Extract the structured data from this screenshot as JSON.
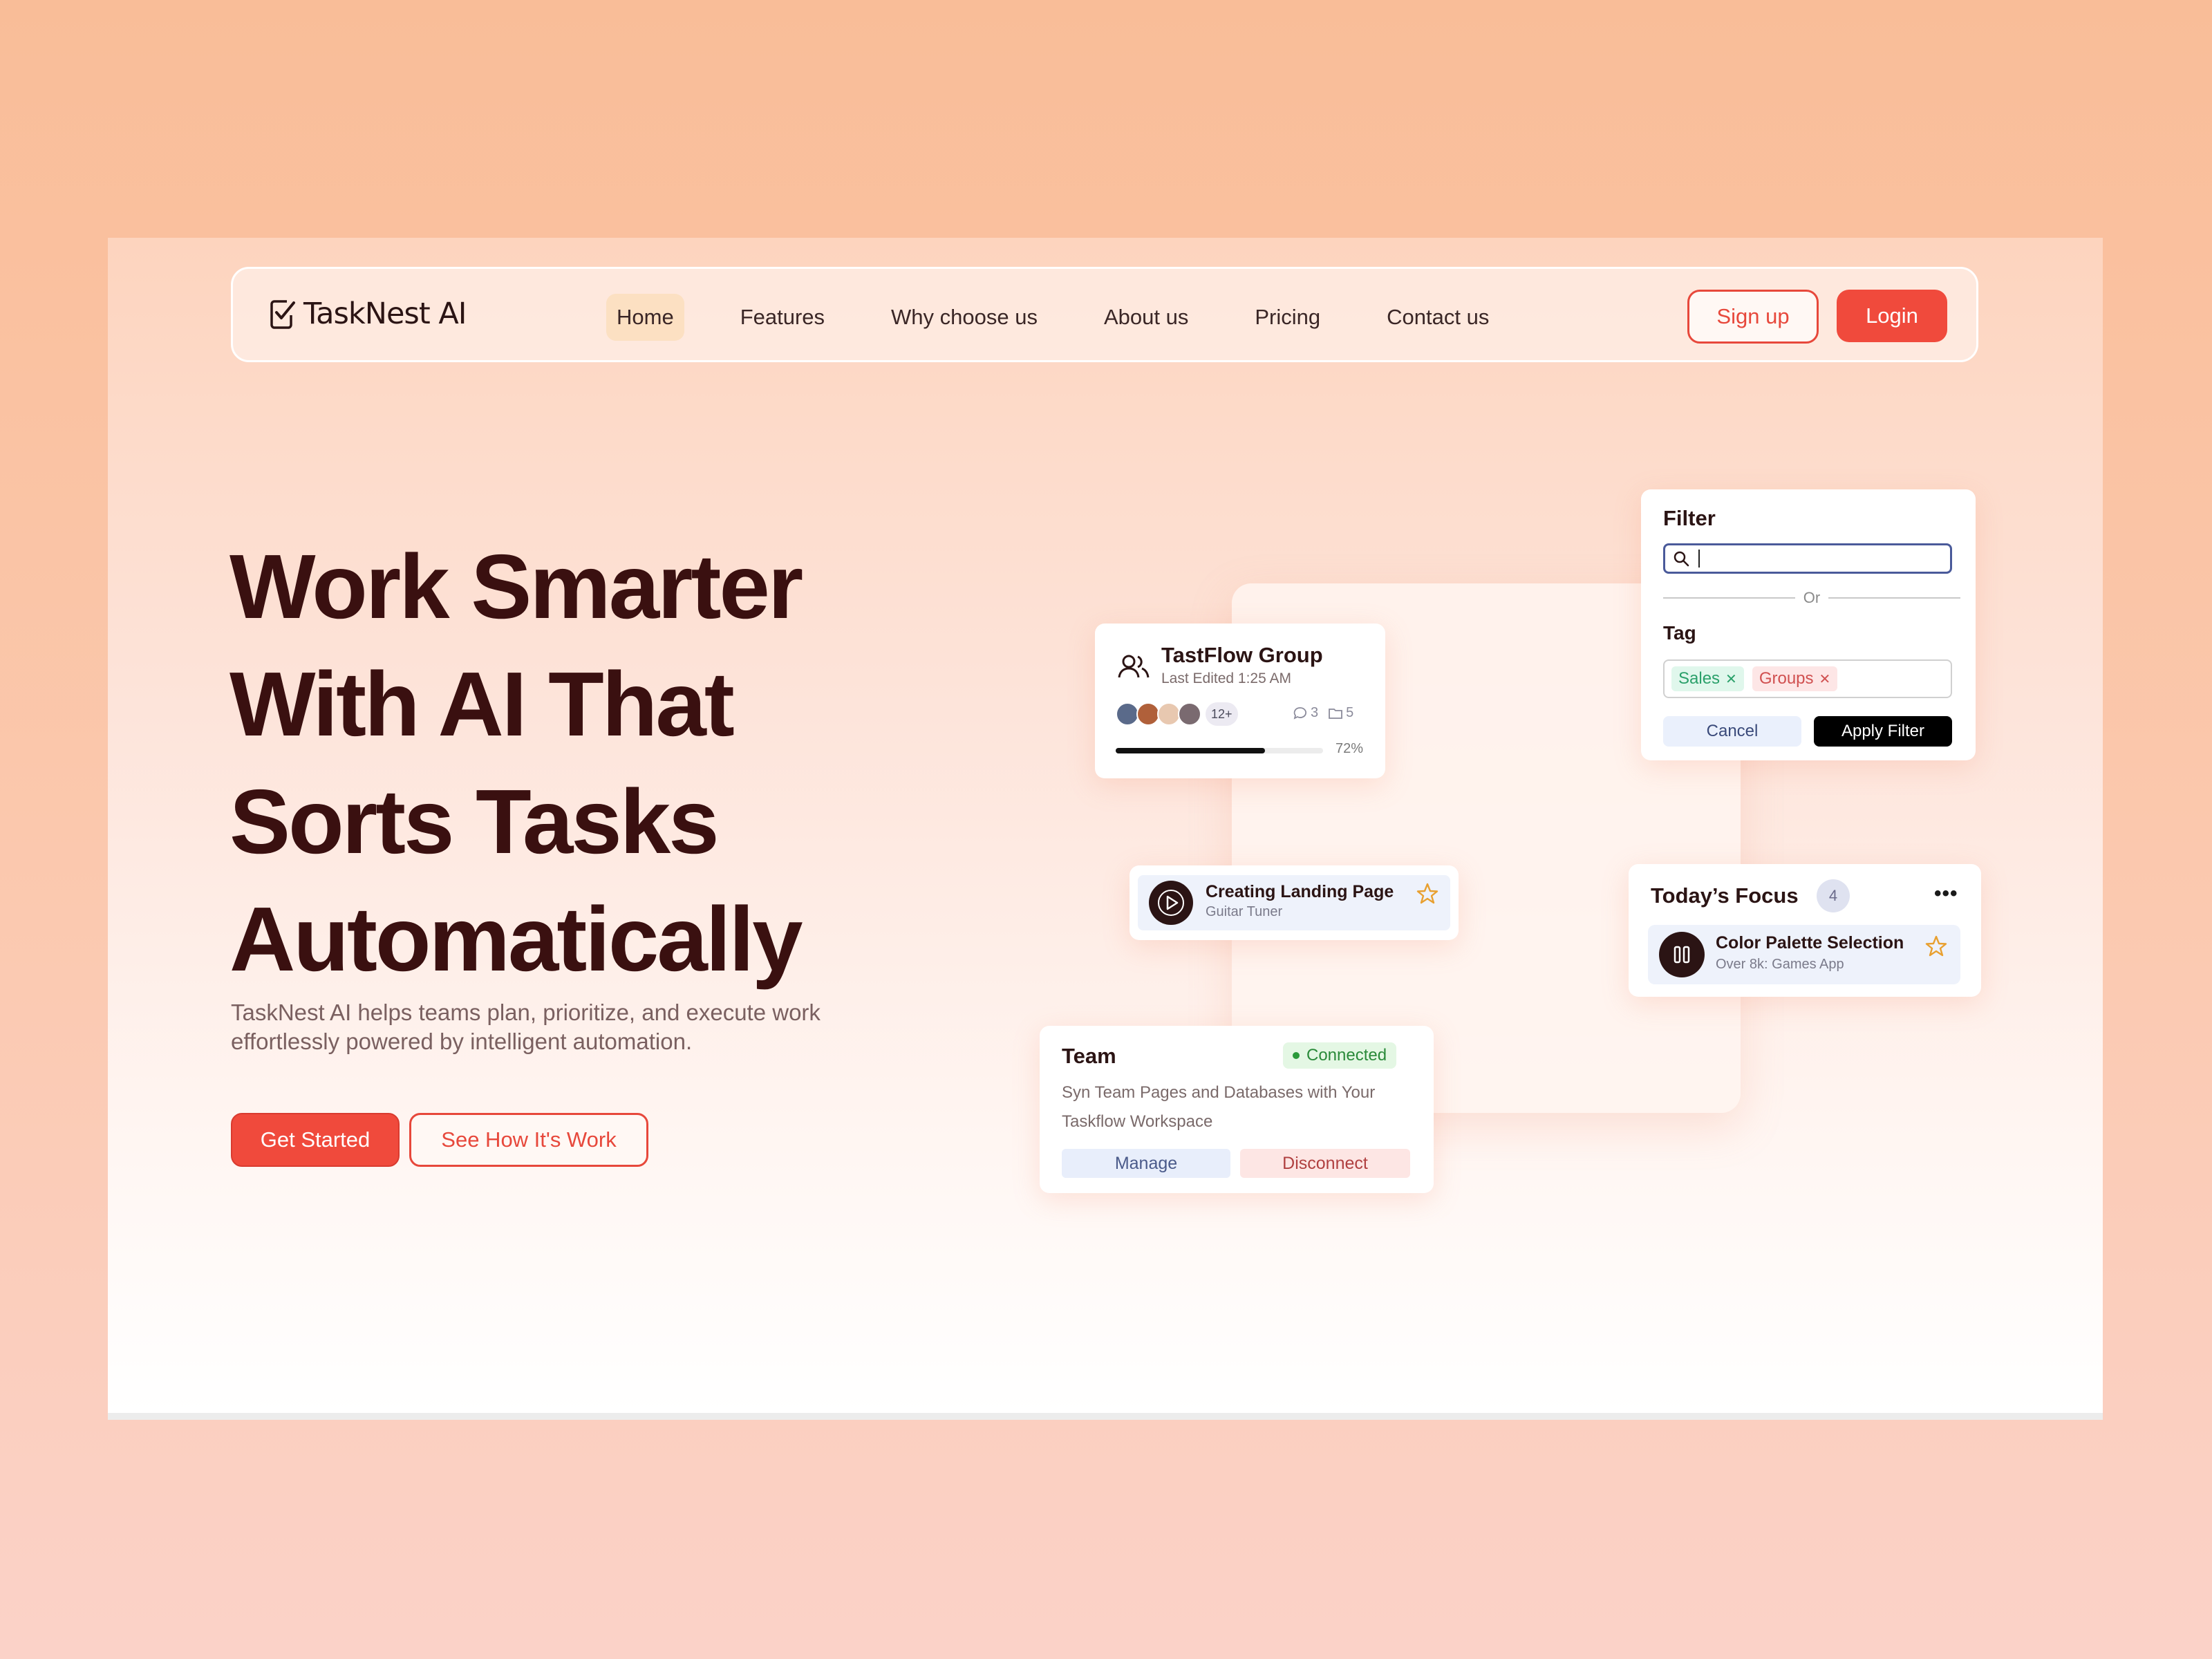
{
  "brand": {
    "name": "TaskNest AI"
  },
  "nav": {
    "links": [
      "Home",
      "Features",
      "Why choose us",
      "About us",
      "Pricing",
      "Contact us"
    ],
    "active_index": 0,
    "signup_label": "Sign up",
    "login_label": "Login"
  },
  "hero": {
    "title_lines": [
      "Work Smarter",
      "With AI That",
      "Sorts Tasks",
      "Automatically"
    ],
    "description": "TaskNest AI helps teams plan, prioritize, and execute work effortlessly powered by intelligent automation.",
    "primary_cta": "Get Started",
    "secondary_cta": "See How It's Work"
  },
  "group_card": {
    "title": "TastFlow Group",
    "subtitle": "Last Edited 1:25 AM",
    "avatar_more": "12+",
    "comments": "3",
    "folders": "5",
    "progress": 0.72,
    "progress_label": "72%"
  },
  "filter_card": {
    "title": "Filter",
    "search_value": "",
    "or_label": "Or",
    "tag_title": "Tag",
    "tags": [
      "Sales",
      "Groups"
    ],
    "cancel_label": "Cancel",
    "apply_label": "Apply Filter"
  },
  "landing_card": {
    "title": "Creating Landing Page",
    "subtitle": "Guitar Tuner"
  },
  "focus_card": {
    "title": "Today’s Focus",
    "count": "4",
    "more": "•••",
    "item_title": "Color Palette Selection",
    "item_subtitle": "Over 8k: Games App"
  },
  "team_card": {
    "title": "Team",
    "status": "Connected",
    "description": "Syn Team Pages and Databases with Your Taskflow Workspace",
    "manage_label": "Manage",
    "disconnect_label": "Disconnect"
  },
  "colors": {
    "accent": "#f04a3c",
    "heading": "#3a1010",
    "background_top": "#f9bd98",
    "background_bottom": "#fbd2c8"
  },
  "icons": {
    "logo": "check-list-icon",
    "group": "users-icon",
    "comments": "chat-icon",
    "folders": "folder-icon",
    "search": "search-icon",
    "play": "play-icon",
    "pause": "pause-icon",
    "star": "star-icon"
  }
}
